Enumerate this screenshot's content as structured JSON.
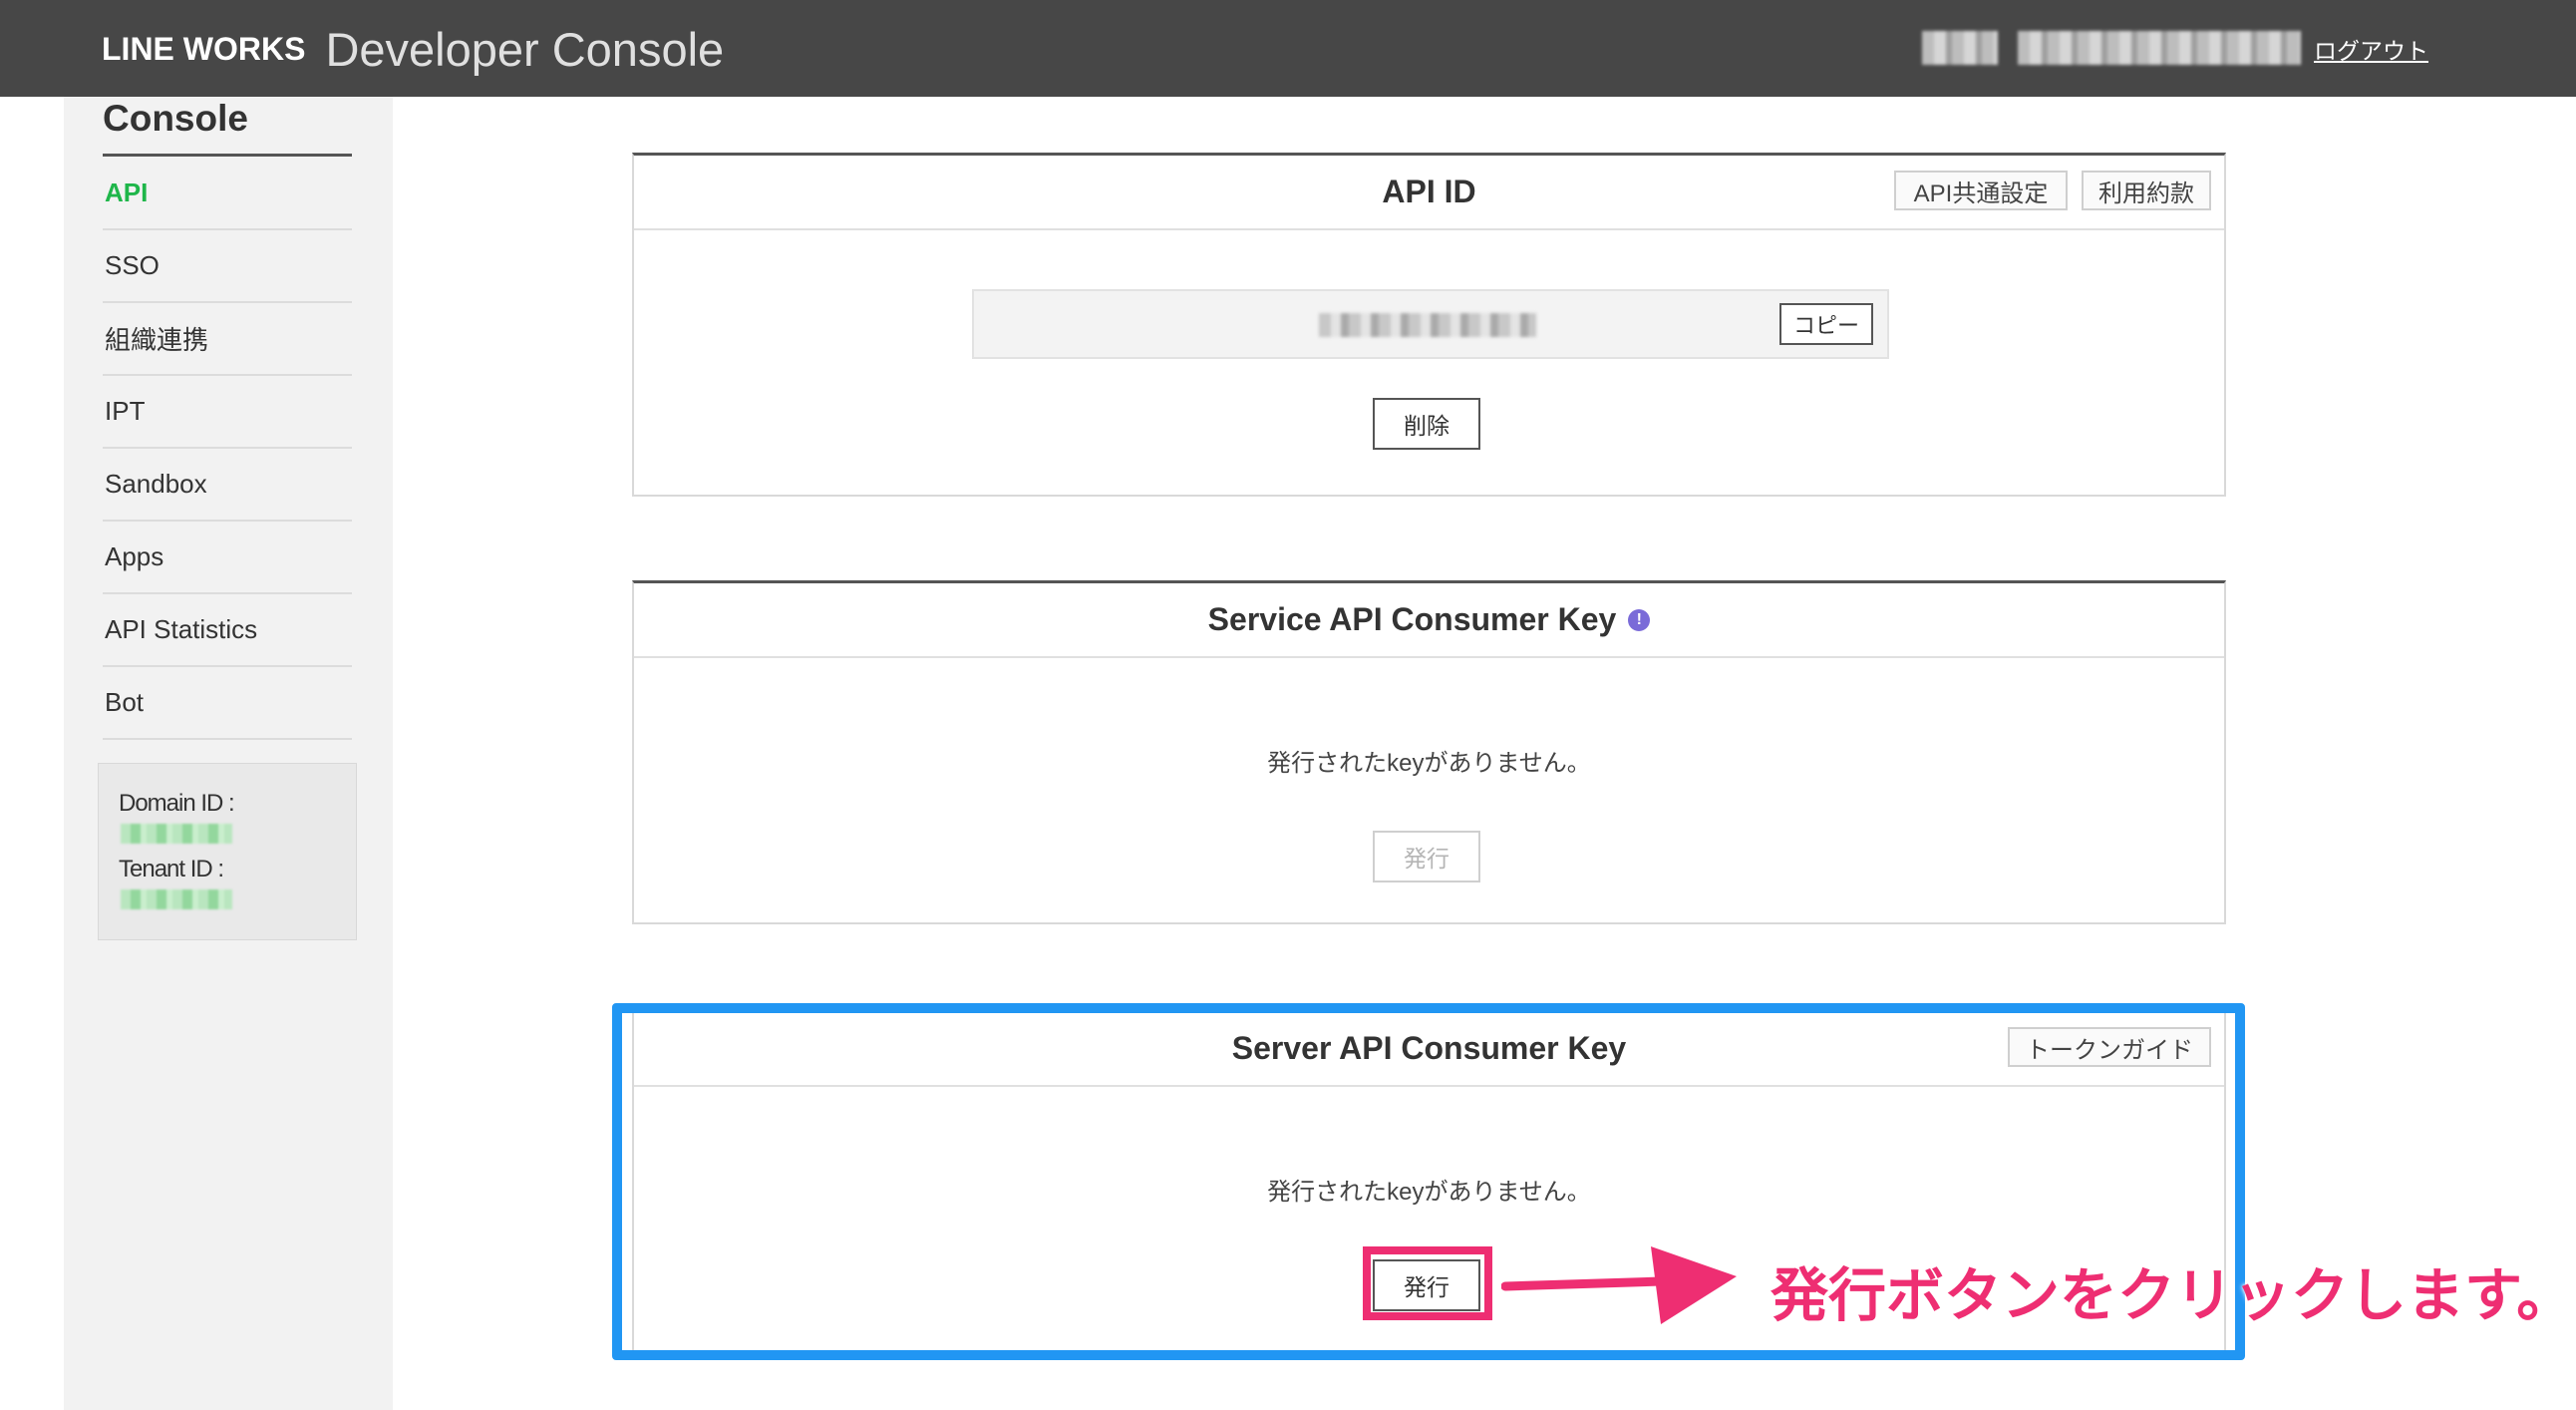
{
  "header": {
    "brand": "LINE WORKS",
    "product": "Developer Console",
    "logout_label": "ログアウト"
  },
  "sidebar": {
    "title": "Console",
    "items": [
      {
        "label": "API",
        "active": true
      },
      {
        "label": "SSO"
      },
      {
        "label": "組織連携"
      },
      {
        "label": "IPT"
      },
      {
        "label": "Sandbox"
      },
      {
        "label": "Apps"
      },
      {
        "label": "API Statistics"
      },
      {
        "label": "Bot"
      }
    ],
    "info": {
      "domain_label": "Domain ID :",
      "tenant_label": "Tenant ID :"
    }
  },
  "api_id_card": {
    "title": "API ID",
    "common_settings_label": "API共通設定",
    "terms_label": "利用約款",
    "copy_label": "コピー",
    "delete_label": "削除"
  },
  "service_key_card": {
    "title": "Service API Consumer Key",
    "empty_message": "発行されたkeyがありません。",
    "issue_label": "発行"
  },
  "server_key_card": {
    "title": "Server API Consumer Key",
    "token_guide_label": "トークンガイド",
    "empty_message": "発行されたkeyがありません。",
    "issue_label": "発行"
  },
  "annotation": {
    "text": "発行ボタンをクリックします。",
    "color": "#ee2e72",
    "frame_color": "#2196f3"
  },
  "colors": {
    "header_bg": "#474747",
    "active_nav": "#1fb64a",
    "info_icon": "#7a6bd8"
  }
}
